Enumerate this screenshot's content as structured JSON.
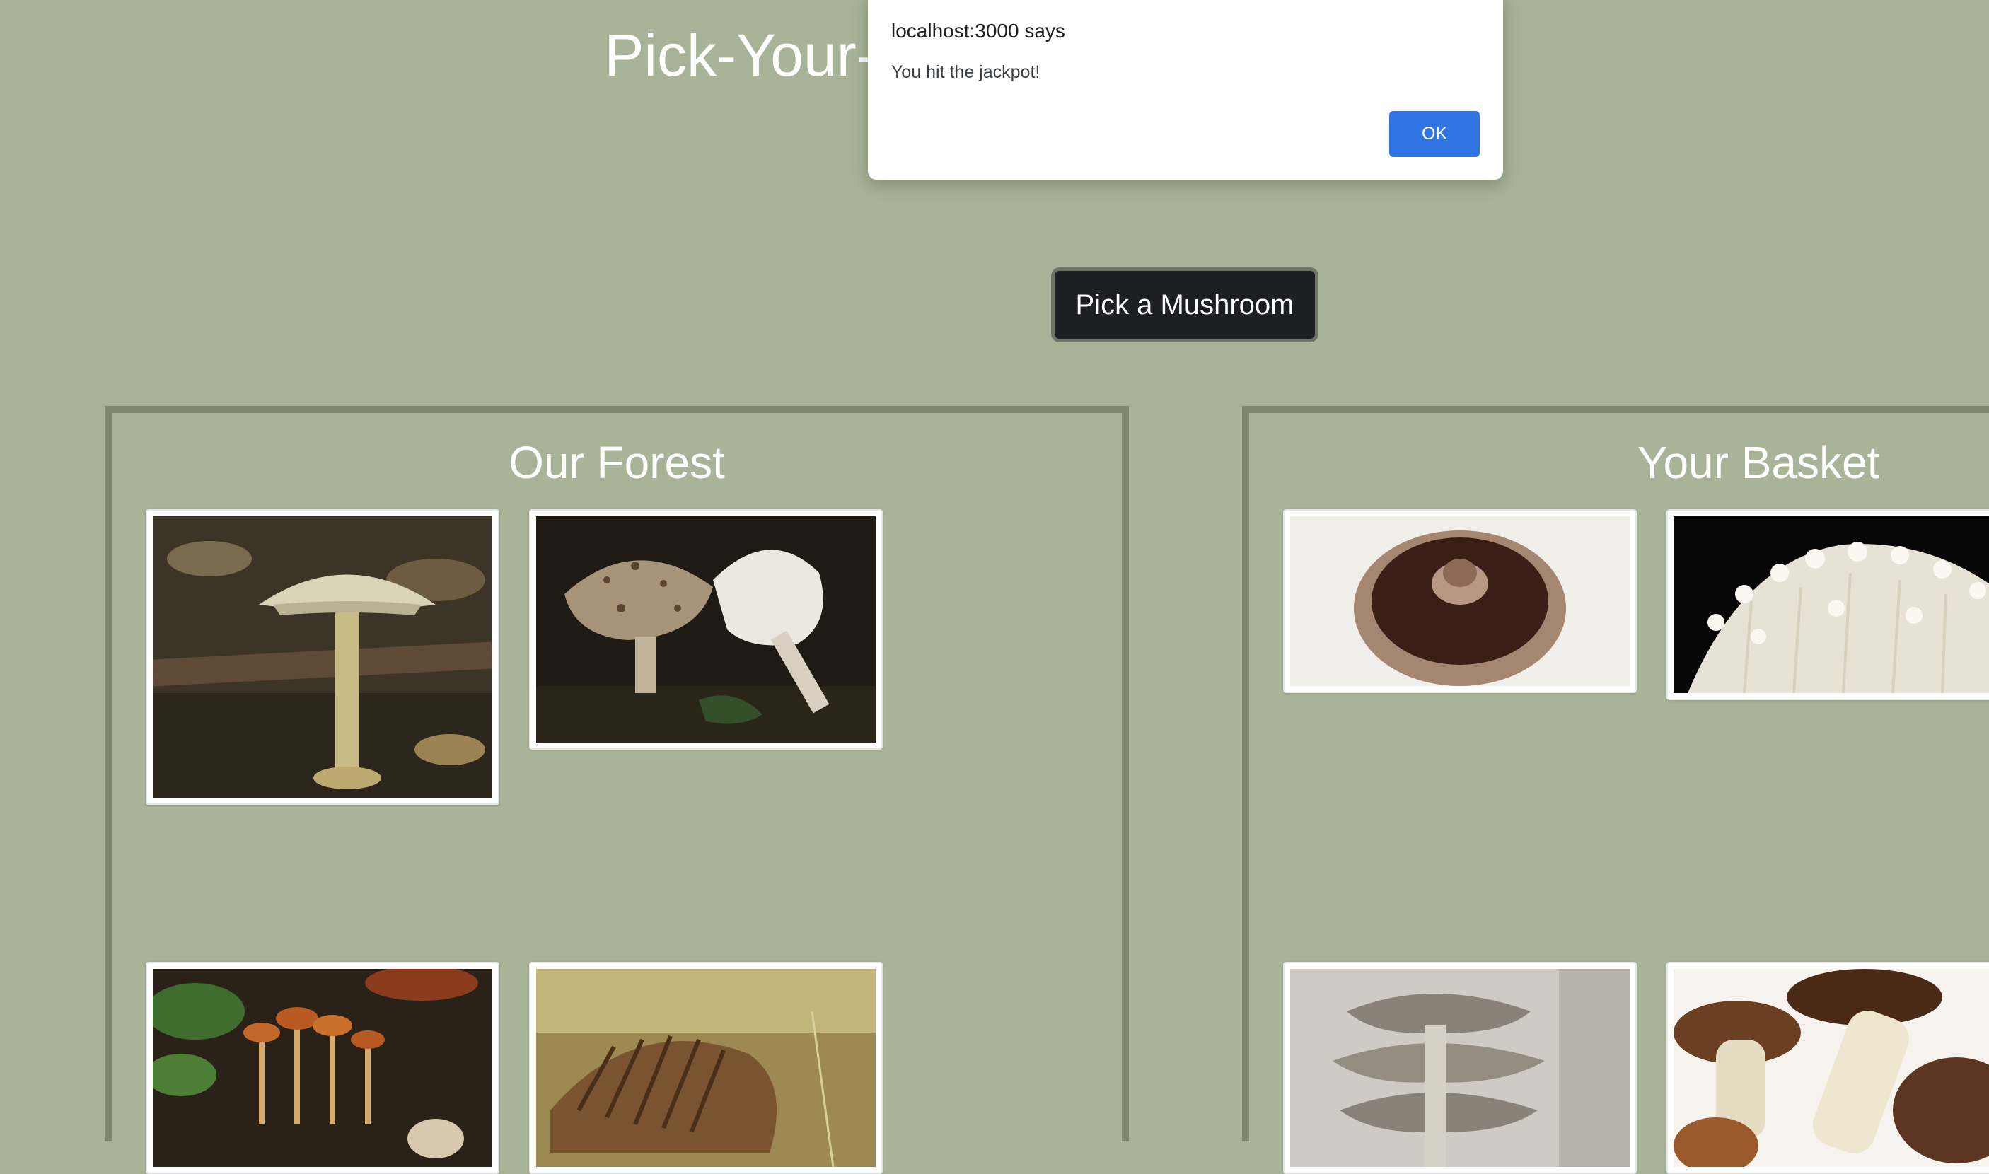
{
  "page": {
    "title": "Pick-Your-Mushroom Counter",
    "pick_button_label": "Pick a Mushroom"
  },
  "forest": {
    "title": "Our Forest",
    "mushrooms": [
      {
        "icon": "death-cap-mushroom-photo"
      },
      {
        "icon": "parasol-mushroom-photo"
      },
      {
        "icon": "orange-mushroom-cluster-photo"
      },
      {
        "icon": "brown-gilled-mushroom-photo"
      }
    ]
  },
  "basket": {
    "title": "Your Basket",
    "mushrooms": [
      {
        "icon": "portobello-mushroom-photo"
      },
      {
        "icon": "enoki-mushroom-photo"
      },
      {
        "icon": "oyster-mushroom-photo"
      },
      {
        "icon": "porcini-mushroom-photo"
      }
    ]
  },
  "dialog": {
    "origin": "localhost:3000 says",
    "message": "You hit the jackpot!",
    "ok_label": "OK"
  },
  "colors": {
    "background": "#a7b498",
    "panel_border": "#7e8a70",
    "button_dark": "#1d1f23",
    "dialog_accent": "#2f74e0"
  }
}
